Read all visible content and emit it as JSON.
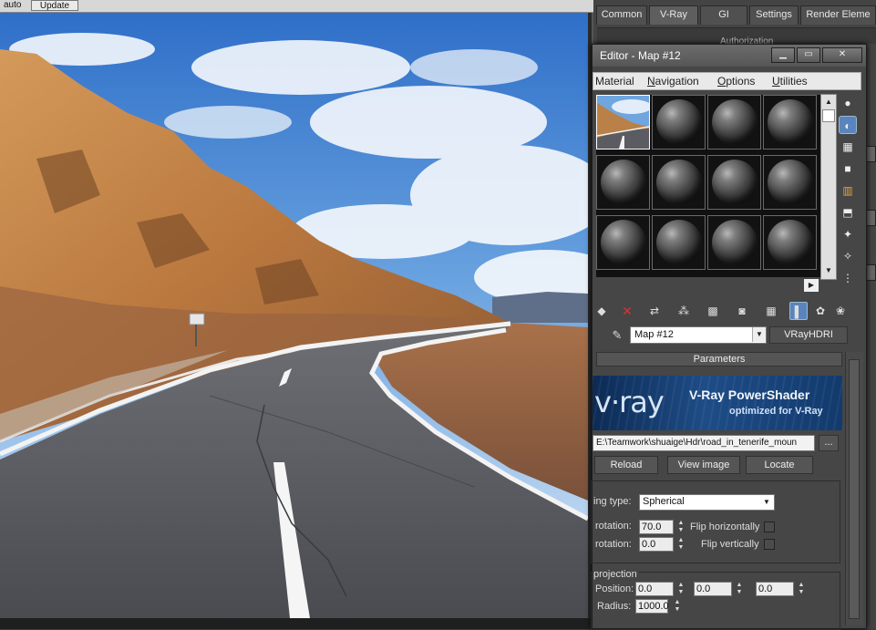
{
  "framebuffer": {
    "auto_label": "auto",
    "update_button": "Update"
  },
  "render_setup": {
    "tabs": [
      "Common",
      "V-Ray",
      "GI",
      "Settings",
      "Render Eleme"
    ],
    "active_tab": "V-Ray",
    "rollout_label": "Authorization"
  },
  "material_editor": {
    "title": "Editor - Map #12",
    "window_buttons": [
      "minimize",
      "maximize",
      "close"
    ],
    "menu": [
      {
        "pre": "",
        "u": "",
        "rest": "Material"
      },
      {
        "pre": "",
        "u": "N",
        "rest": "avigation"
      },
      {
        "pre": "",
        "u": "O",
        "rest": "ptions"
      },
      {
        "pre": "",
        "u": "U",
        "rest": "tilities"
      }
    ],
    "slot_count": 12,
    "selected_slot": 0,
    "side_tools": [
      "sample-type-icon",
      "backlight-icon",
      "background-checker-icon",
      "sample-uv-tiling-icon",
      "video-color-check-icon",
      "make-preview-icon",
      "options-icon",
      "select-by-material-icon",
      "material-map-navigator-icon"
    ],
    "toolbar": [
      "get-material-icon",
      "delete-icon",
      "put-to-library-icon",
      "material-id-icon",
      "show-shaded-icon",
      "show-end-result-icon",
      "go-to-parent-icon",
      "go-forward-icon",
      "show-map-icon",
      "background-icon",
      "sphere-icon"
    ],
    "map_name": "Map #12",
    "map_type": "VRayHDRI",
    "parameters_header": "Parameters",
    "banner": {
      "logo": "v·ray",
      "title": "V-Ray PowerShader",
      "subtitle": "optimized for V-Ray"
    },
    "hdr_path": "E:\\Teamwork\\shuaige\\Hdr\\road_in_tenerife_moun",
    "browse_label": "...",
    "buttons": {
      "reload": "Reload",
      "view_image": "View image",
      "locate": "Locate"
    },
    "mapping_type_label": "ing type:",
    "mapping_type_value": "Spherical",
    "h_rotation_label": "rotation:",
    "h_rotation_value": "70.0",
    "v_rotation_label": "rotation:",
    "v_rotation_value": "0.0",
    "flip_h_label": "Flip horizontally",
    "flip_v_label": "Flip vertically",
    "projection_label": "projection",
    "position_label": "Position:",
    "position_values": [
      "0.0",
      "0.0",
      "0.0"
    ],
    "radius_label": "Radius:",
    "radius_value": "1000.0"
  },
  "colors": {
    "accent_selected": "#5a84bd",
    "panel_bg": "#464646",
    "banner_blue": "#1e4c86",
    "delete_red": "#e03030"
  }
}
